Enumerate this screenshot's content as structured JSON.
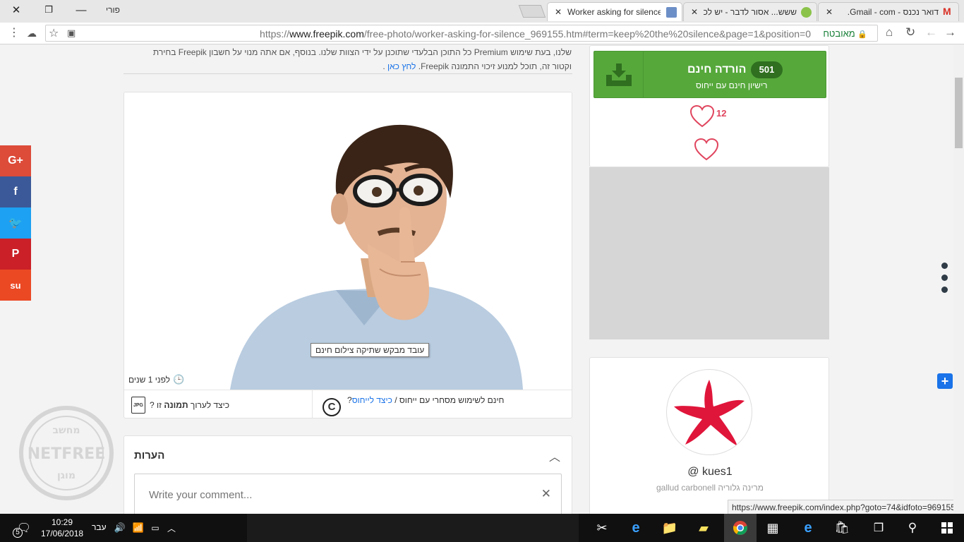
{
  "browser": {
    "profile_label": "פורי",
    "tabs": [
      {
        "title": "Worker asking for silence",
        "active": true
      },
      {
        "title": "ששש... אסור לדבר - יש לכ",
        "active": false
      },
      {
        "title": "דואר נכנס - Gmail - com.",
        "active": false
      }
    ],
    "security_label": "מאובטח",
    "url_scheme": "https://",
    "url_domain": "www.freepik.com",
    "url_path": "/free-photo/worker-asking-for-silence_969155.htm#term=keep%20the%20silence&page=1&position=0"
  },
  "page": {
    "license_text_line1": "שלנו, בעת שימוש Premium כל התוכן הבלעדי שתוכנן על ידי הצוות שלנו. בנוסף, אם אתה מנוי על חשבון Freepik בחירת",
    "license_text_line2_pre": "וקטור זה, תוכל למנוע זיכוי התמונה Freepik. ",
    "license_link": "לחץ כאן",
    "license_text_end": " .",
    "photo_tooltip": "עובד מבקש שתיקה צילום חינם",
    "photo_age": "לפני 1 שנים",
    "edit_prefix": "כיצד לערוך ",
    "edit_bold": "תמונה",
    "edit_suffix": " זו ?",
    "usage_text": "חינם לשימוש מסחרי עם ייחוס / ",
    "usage_link": "כיצד לייחוס",
    "usage_q": "?",
    "comments_title": "הערות",
    "comment_placeholder": "Write your comment...",
    "download": {
      "count": "501",
      "title": "הורדה חינם",
      "subtitle": "רישיון חינם עם ייחוס"
    },
    "likes": "12",
    "author": {
      "name": "kues1 @",
      "subtitle": "מרינה גלוריה gallud carbonell"
    },
    "status_url": "https://www.freepik.com/index.php?goto=74&idfoto=969155",
    "watermark_text": [
      "מחשב",
      "NETFREE",
      "מוגן"
    ],
    "social": [
      {
        "label": "G+",
        "color": "#dd4b39"
      },
      {
        "label": "f",
        "color": "#3b5998"
      },
      {
        "label": "t",
        "color": "#1da1f2"
      },
      {
        "label": "P",
        "color": "#cb2027"
      },
      {
        "label": "su",
        "color": "#eb4924"
      }
    ]
  },
  "taskbar": {
    "time": "10:29",
    "date": "17/06/2018",
    "language": "עבר",
    "notifications": "5"
  }
}
